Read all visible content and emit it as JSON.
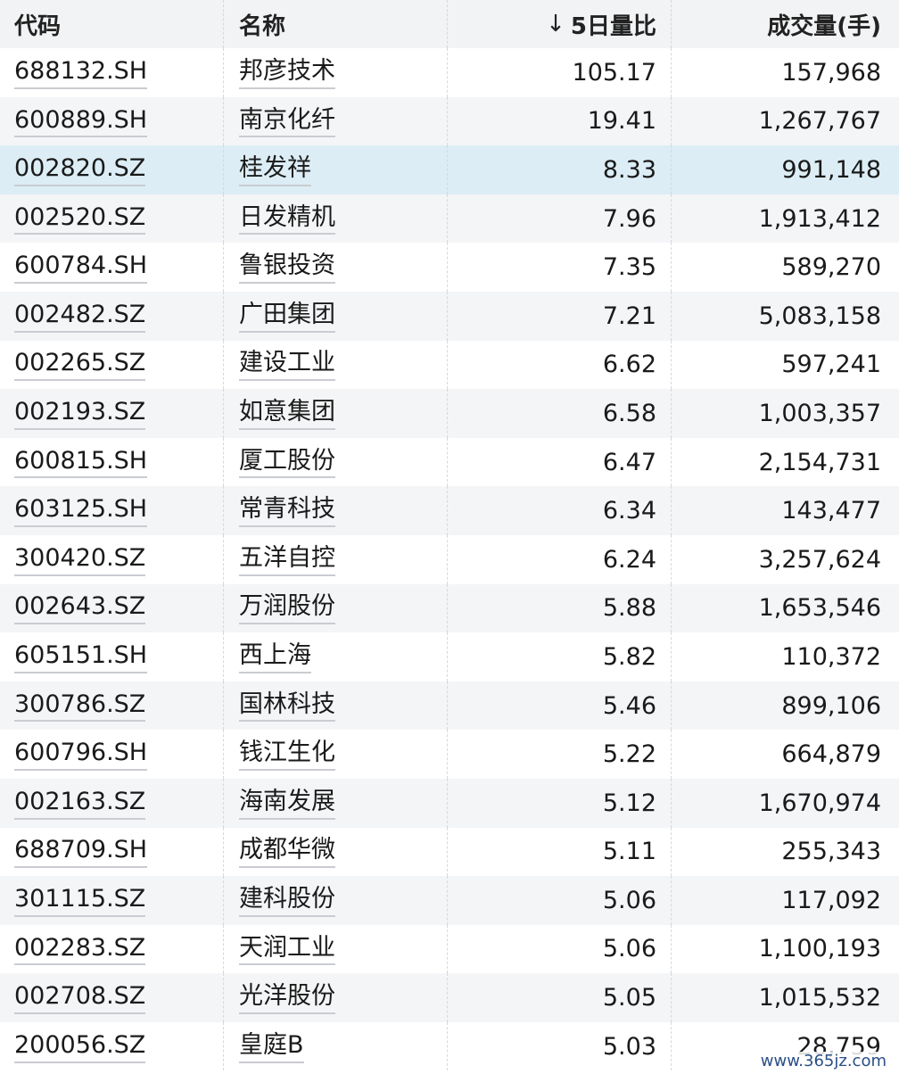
{
  "header": {
    "code": "代码",
    "name": "名称",
    "ratio_arrow": "↓",
    "ratio": "5日量比",
    "volume": "成交量(手)"
  },
  "rows": [
    {
      "code": "688132.SH",
      "name": "邦彦技术",
      "ratio": "105.17",
      "volume": "157,968"
    },
    {
      "code": "600889.SH",
      "name": "南京化纤",
      "ratio": "19.41",
      "volume": "1,267,767"
    },
    {
      "code": "002820.SZ",
      "name": "桂发祥",
      "ratio": "8.33",
      "volume": "991,148"
    },
    {
      "code": "002520.SZ",
      "name": "日发精机",
      "ratio": "7.96",
      "volume": "1,913,412"
    },
    {
      "code": "600784.SH",
      "name": "鲁银投资",
      "ratio": "7.35",
      "volume": "589,270"
    },
    {
      "code": "002482.SZ",
      "name": "广田集团",
      "ratio": "7.21",
      "volume": "5,083,158"
    },
    {
      "code": "002265.SZ",
      "name": "建设工业",
      "ratio": "6.62",
      "volume": "597,241"
    },
    {
      "code": "002193.SZ",
      "name": "如意集团",
      "ratio": "6.58",
      "volume": "1,003,357"
    },
    {
      "code": "600815.SH",
      "name": "厦工股份",
      "ratio": "6.47",
      "volume": "2,154,731"
    },
    {
      "code": "603125.SH",
      "name": "常青科技",
      "ratio": "6.34",
      "volume": "143,477"
    },
    {
      "code": "300420.SZ",
      "name": "五洋自控",
      "ratio": "6.24",
      "volume": "3,257,624"
    },
    {
      "code": "002643.SZ",
      "name": "万润股份",
      "ratio": "5.88",
      "volume": "1,653,546"
    },
    {
      "code": "605151.SH",
      "name": "西上海",
      "ratio": "5.82",
      "volume": "110,372"
    },
    {
      "code": "300786.SZ",
      "name": "国林科技",
      "ratio": "5.46",
      "volume": "899,106"
    },
    {
      "code": "600796.SH",
      "name": "钱江生化",
      "ratio": "5.22",
      "volume": "664,879"
    },
    {
      "code": "002163.SZ",
      "name": "海南发展",
      "ratio": "5.12",
      "volume": "1,670,974"
    },
    {
      "code": "688709.SH",
      "name": "成都华微",
      "ratio": "5.11",
      "volume": "255,343"
    },
    {
      "code": "301115.SZ",
      "name": "建科股份",
      "ratio": "5.06",
      "volume": "117,092"
    },
    {
      "code": "002283.SZ",
      "name": "天润工业",
      "ratio": "5.06",
      "volume": "1,100,193"
    },
    {
      "code": "002708.SZ",
      "name": "光洋股份",
      "ratio": "5.05",
      "volume": "1,015,532"
    },
    {
      "code": "200056.SZ",
      "name": "皇庭B",
      "ratio": "5.03",
      "volume": "28,759"
    }
  ],
  "selected_row": "002820.SZ",
  "watermark": "www.365jz.com"
}
